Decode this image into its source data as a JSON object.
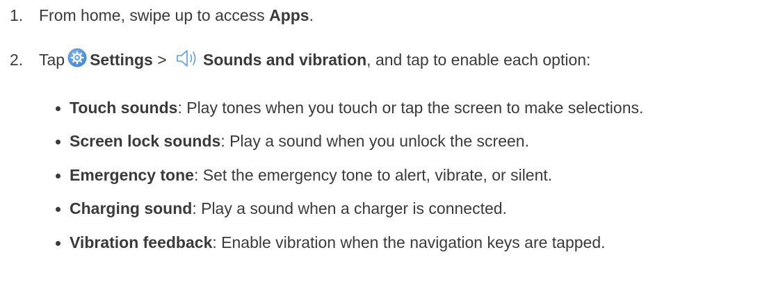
{
  "steps": [
    {
      "number": "1.",
      "text_before": "From home, swipe up to access ",
      "bold": "Apps",
      "text_after": "."
    },
    {
      "number": "2.",
      "text_before": "Tap",
      "settings_label": "Settings",
      "separator": " > ",
      "sounds_label": "Sounds and vibration",
      "text_after": ", and tap to enable each option:"
    }
  ],
  "options": [
    {
      "title": "Touch sounds",
      "description": ": Play tones when you touch or tap the screen to make selections."
    },
    {
      "title": "Screen lock sounds",
      "description": ": Play a sound when you unlock the screen."
    },
    {
      "title": "Emergency tone",
      "description": ": Set the emergency tone to alert, vibrate, or silent."
    },
    {
      "title": "Charging sound",
      "description": ": Play a sound when a charger is connected."
    },
    {
      "title": "Vibration feedback",
      "description": ": Enable vibration when the navigation keys are tapped."
    }
  ],
  "icons": {
    "settings": "settings-gear-icon",
    "sounds": "speaker-volume-icon"
  },
  "colors": {
    "text": "#3a3a3a",
    "settings_icon_bg": "#4a8ee0"
  }
}
